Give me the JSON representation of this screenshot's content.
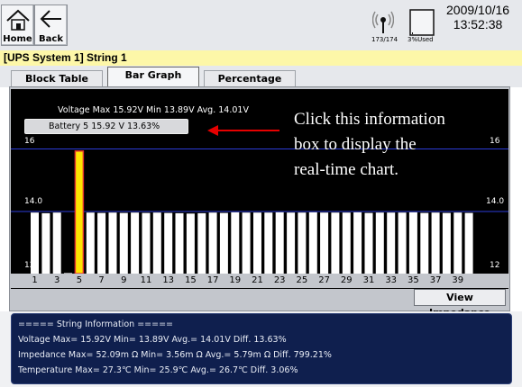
{
  "toolbar": {
    "home_label": "Home",
    "back_label": "Back",
    "signal_count": "173/174",
    "storage_used": "3%Used",
    "date": "2009/10/16",
    "time": "13:52:38",
    "icons": [
      "home-icon",
      "back-arrow-icon",
      "antenna-icon",
      "storage-icon"
    ]
  },
  "title": "[UPS System 1] String 1",
  "tabs": [
    {
      "label": "Block Table",
      "active": false
    },
    {
      "label": "Bar Graph",
      "active": true
    },
    {
      "label": "Percentage",
      "active": false
    }
  ],
  "graph": {
    "stats_line": "Voltage Max 15.92V  Min 13.89V  Avg. 14.01V",
    "info_box": "Battery 5 15.92 V 13.63%",
    "callout_lines": [
      "Click this information",
      "box to display the",
      "real-time chart."
    ],
    "y_top_label": "16",
    "y_top_label_right": "16",
    "y_mid_label": "14.0",
    "y_mid_label_right": "14.0",
    "y_bottom_label": "12",
    "y_bottom_label_right": "12",
    "view_impedance_label": "View Impedance",
    "colors": {
      "bar": "#ffffff",
      "highlight_bar": "#ffe400",
      "highlight_edge": "#e03030",
      "ref_line": "#2b3bd8",
      "arrow": "#e60000"
    }
  },
  "chart_data": {
    "type": "bar",
    "categories": [
      "1",
      "2",
      "3",
      "4",
      "5",
      "6",
      "7",
      "8",
      "9",
      "10",
      "11",
      "12",
      "13",
      "14",
      "15",
      "16",
      "17",
      "18",
      "19",
      "20",
      "21",
      "22",
      "23",
      "24",
      "25",
      "26",
      "27",
      "28",
      "29",
      "30",
      "31",
      "32",
      "33",
      "34",
      "35",
      "36",
      "37",
      "38",
      "39",
      "40"
    ],
    "x_tick_labels": [
      "1",
      "3",
      "5",
      "7",
      "9",
      "11",
      "13",
      "15",
      "17",
      "19",
      "21",
      "23",
      "25",
      "27",
      "29",
      "31",
      "33",
      "35",
      "37",
      "39"
    ],
    "values": [
      13.95,
      13.93,
      13.95,
      12.0,
      15.92,
      13.95,
      13.94,
      13.95,
      13.94,
      13.95,
      13.94,
      13.95,
      13.94,
      13.93,
      13.92,
      13.93,
      13.95,
      13.94,
      13.96,
      13.95,
      13.95,
      13.95,
      13.96,
      13.95,
      13.95,
      13.96,
      13.95,
      13.95,
      13.95,
      13.96,
      13.94,
      13.95,
      13.95,
      13.95,
      13.96,
      13.94,
      13.95,
      13.94,
      13.95,
      13.94
    ],
    "highlighted_index": 4,
    "reference_lines": [
      16,
      14.0,
      12
    ],
    "ylim": [
      12,
      16
    ],
    "xlabel": "",
    "ylabel": ""
  },
  "string_info": {
    "header": "===== String Information =====",
    "voltage": "Voltage Max= 15.92V  Min= 13.89V  Avg.= 14.01V Diff. 13.63%",
    "impedance": "Impedance Max= 52.09m Ω  Min= 3.56m Ω  Avg.= 5.79m Ω Diff. 799.21%",
    "temperature": "Temperature Max= 27.3℃  Min= 25.9℃ Avg.= 26.7℃ Diff. 3.06%"
  }
}
